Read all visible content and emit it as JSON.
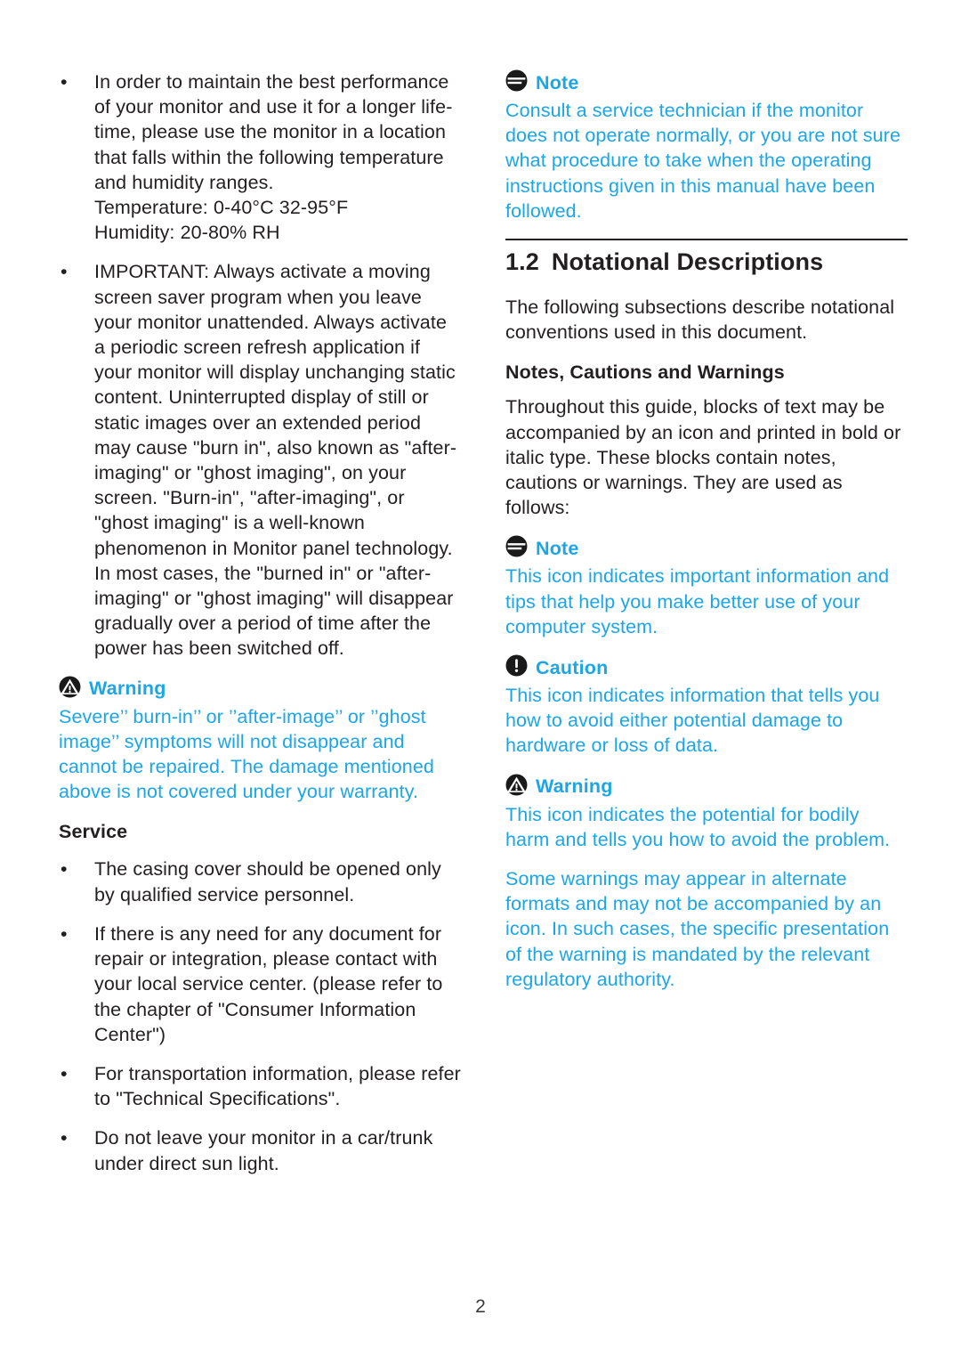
{
  "colors": {
    "accent_blue": "#1BA6E8",
    "text_black": "#231F20"
  },
  "page_number": "2",
  "left_column": {
    "bullets": [
      {
        "text": "In order to maintain the best performance of your monitor and use it for a longer life-time, please use the monitor in a location that falls within the following temperature and humidity ranges.",
        "line2": "Temperature: 0-40°C 32-95°F",
        "line3": "Humidity: 20-80% RH"
      },
      {
        "text": "IMPORTANT: Always activate a moving screen saver program when you leave your monitor unattended. Always activate a periodic screen refresh application if your monitor will display unchanging static content. Uninterrupted display of still or static images over an extended period may cause \"burn in\", also known as \"after-imaging\" or \"ghost imaging\", on your screen. \"Burn-in\", \"after-imaging\", or \"ghost imaging\" is a well-known phenomenon in Monitor panel technology. In most cases, the \"burned in\" or \"after-imaging\" or \"ghost imaging\" will disappear gradually over a period of time after the power has been switched off."
      }
    ],
    "warning": {
      "icon": "warning-triangle-icon",
      "label": "Warning",
      "body": "Severe’’ burn-in’’ or ’’after-image’’ or ’’ghost image’’ symptoms will not disappear and cannot be repaired. The damage mentioned above is not covered under your warranty."
    },
    "service": {
      "title": "Service",
      "bullets": [
        "The casing cover should be opened only by qualified service personnel.",
        "If there is any need for any document for repair or integration, please contact with your local service center. (please refer to the chapter of \"Consumer Information Center\")",
        "For transportation information, please refer to \"Technical Specifications\".",
        "Do not leave your monitor in a car/trunk under direct sun light."
      ]
    }
  },
  "right_column": {
    "note_top": {
      "icon": "note-icon",
      "label": "Note",
      "body": "Consult a service technician if the monitor does not operate normally, or you are not sure what procedure to take when the operating instructions given in this manual have been followed."
    },
    "section": {
      "number": "1.2",
      "title": "Notational Descriptions",
      "intro": "The following subsections describe notational conventions used in this document."
    },
    "subsection": {
      "title": "Notes, Cautions and Warnings",
      "intro": "Throughout this guide, blocks of text may be accompanied by an icon and printed in bold or italic type. These blocks contain notes, cautions or warnings. They are used as follows:"
    },
    "note": {
      "icon": "note-icon",
      "label": "Note",
      "body": "This icon indicates important information and tips that help you make better use of your computer system."
    },
    "caution": {
      "icon": "caution-exclamation-icon",
      "label": "Caution",
      "body": "This icon indicates information that tells you how to avoid either potential damage to hardware or loss of data."
    },
    "warning": {
      "icon": "warning-triangle-icon",
      "label": "Warning",
      "body": "This icon indicates the potential for bodily harm and tells you how to avoid the problem.",
      "body2": "Some warnings may appear in alternate formats and may not be accompanied by an icon. In such cases, the specific presentation of the warning is mandated by the relevant regulatory authority."
    }
  }
}
